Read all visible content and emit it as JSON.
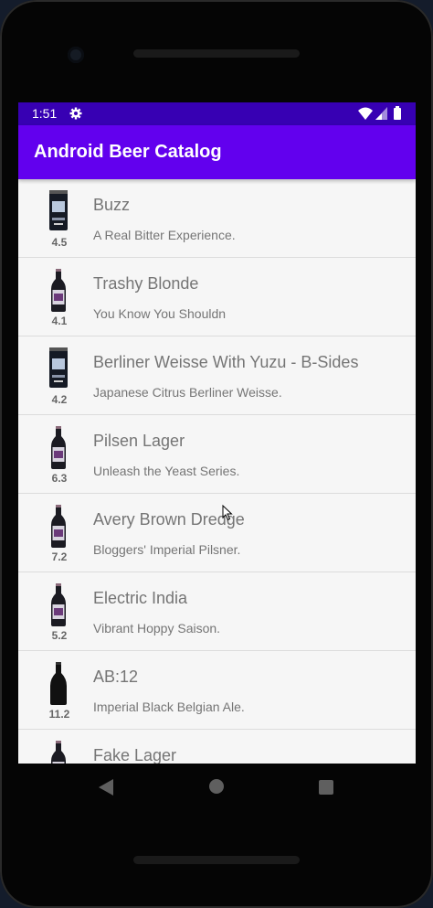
{
  "status_bar": {
    "time": "1:51"
  },
  "app_bar": {
    "title": "Android Beer Catalog"
  },
  "beers": [
    {
      "name": "Buzz",
      "tagline": "A Real Bitter Experience.",
      "abv": "4.5",
      "bottle": "can-icon"
    },
    {
      "name": "Trashy Blonde",
      "tagline": "You Know You Shouldn",
      "abv": "4.1",
      "bottle": "bottle-icon"
    },
    {
      "name": "Berliner Weisse With Yuzu - B-Sides",
      "tagline": "Japanese Citrus Berliner Weisse.",
      "abv": "4.2",
      "bottle": "can-icon"
    },
    {
      "name": "Pilsen Lager",
      "tagline": "Unleash the Yeast Series.",
      "abv": "6.3",
      "bottle": "bottle-icon"
    },
    {
      "name": "Avery Brown Dredge",
      "tagline": "Bloggers' Imperial Pilsner.",
      "abv": "7.2",
      "bottle": "bottle-icon"
    },
    {
      "name": "Electric India",
      "tagline": "Vibrant Hoppy Saison.",
      "abv": "5.2",
      "bottle": "bottle-icon"
    },
    {
      "name": "AB:12",
      "tagline": "Imperial Black Belgian Ale.",
      "abv": "11.2",
      "bottle": "dark-bottle-icon"
    },
    {
      "name": "Fake Lager",
      "tagline": "",
      "abv": "",
      "bottle": "bottle-icon"
    }
  ],
  "colors": {
    "status_bar": "#3700b3",
    "app_bar": "#6200ee",
    "list_background": "#f6f6f6"
  }
}
